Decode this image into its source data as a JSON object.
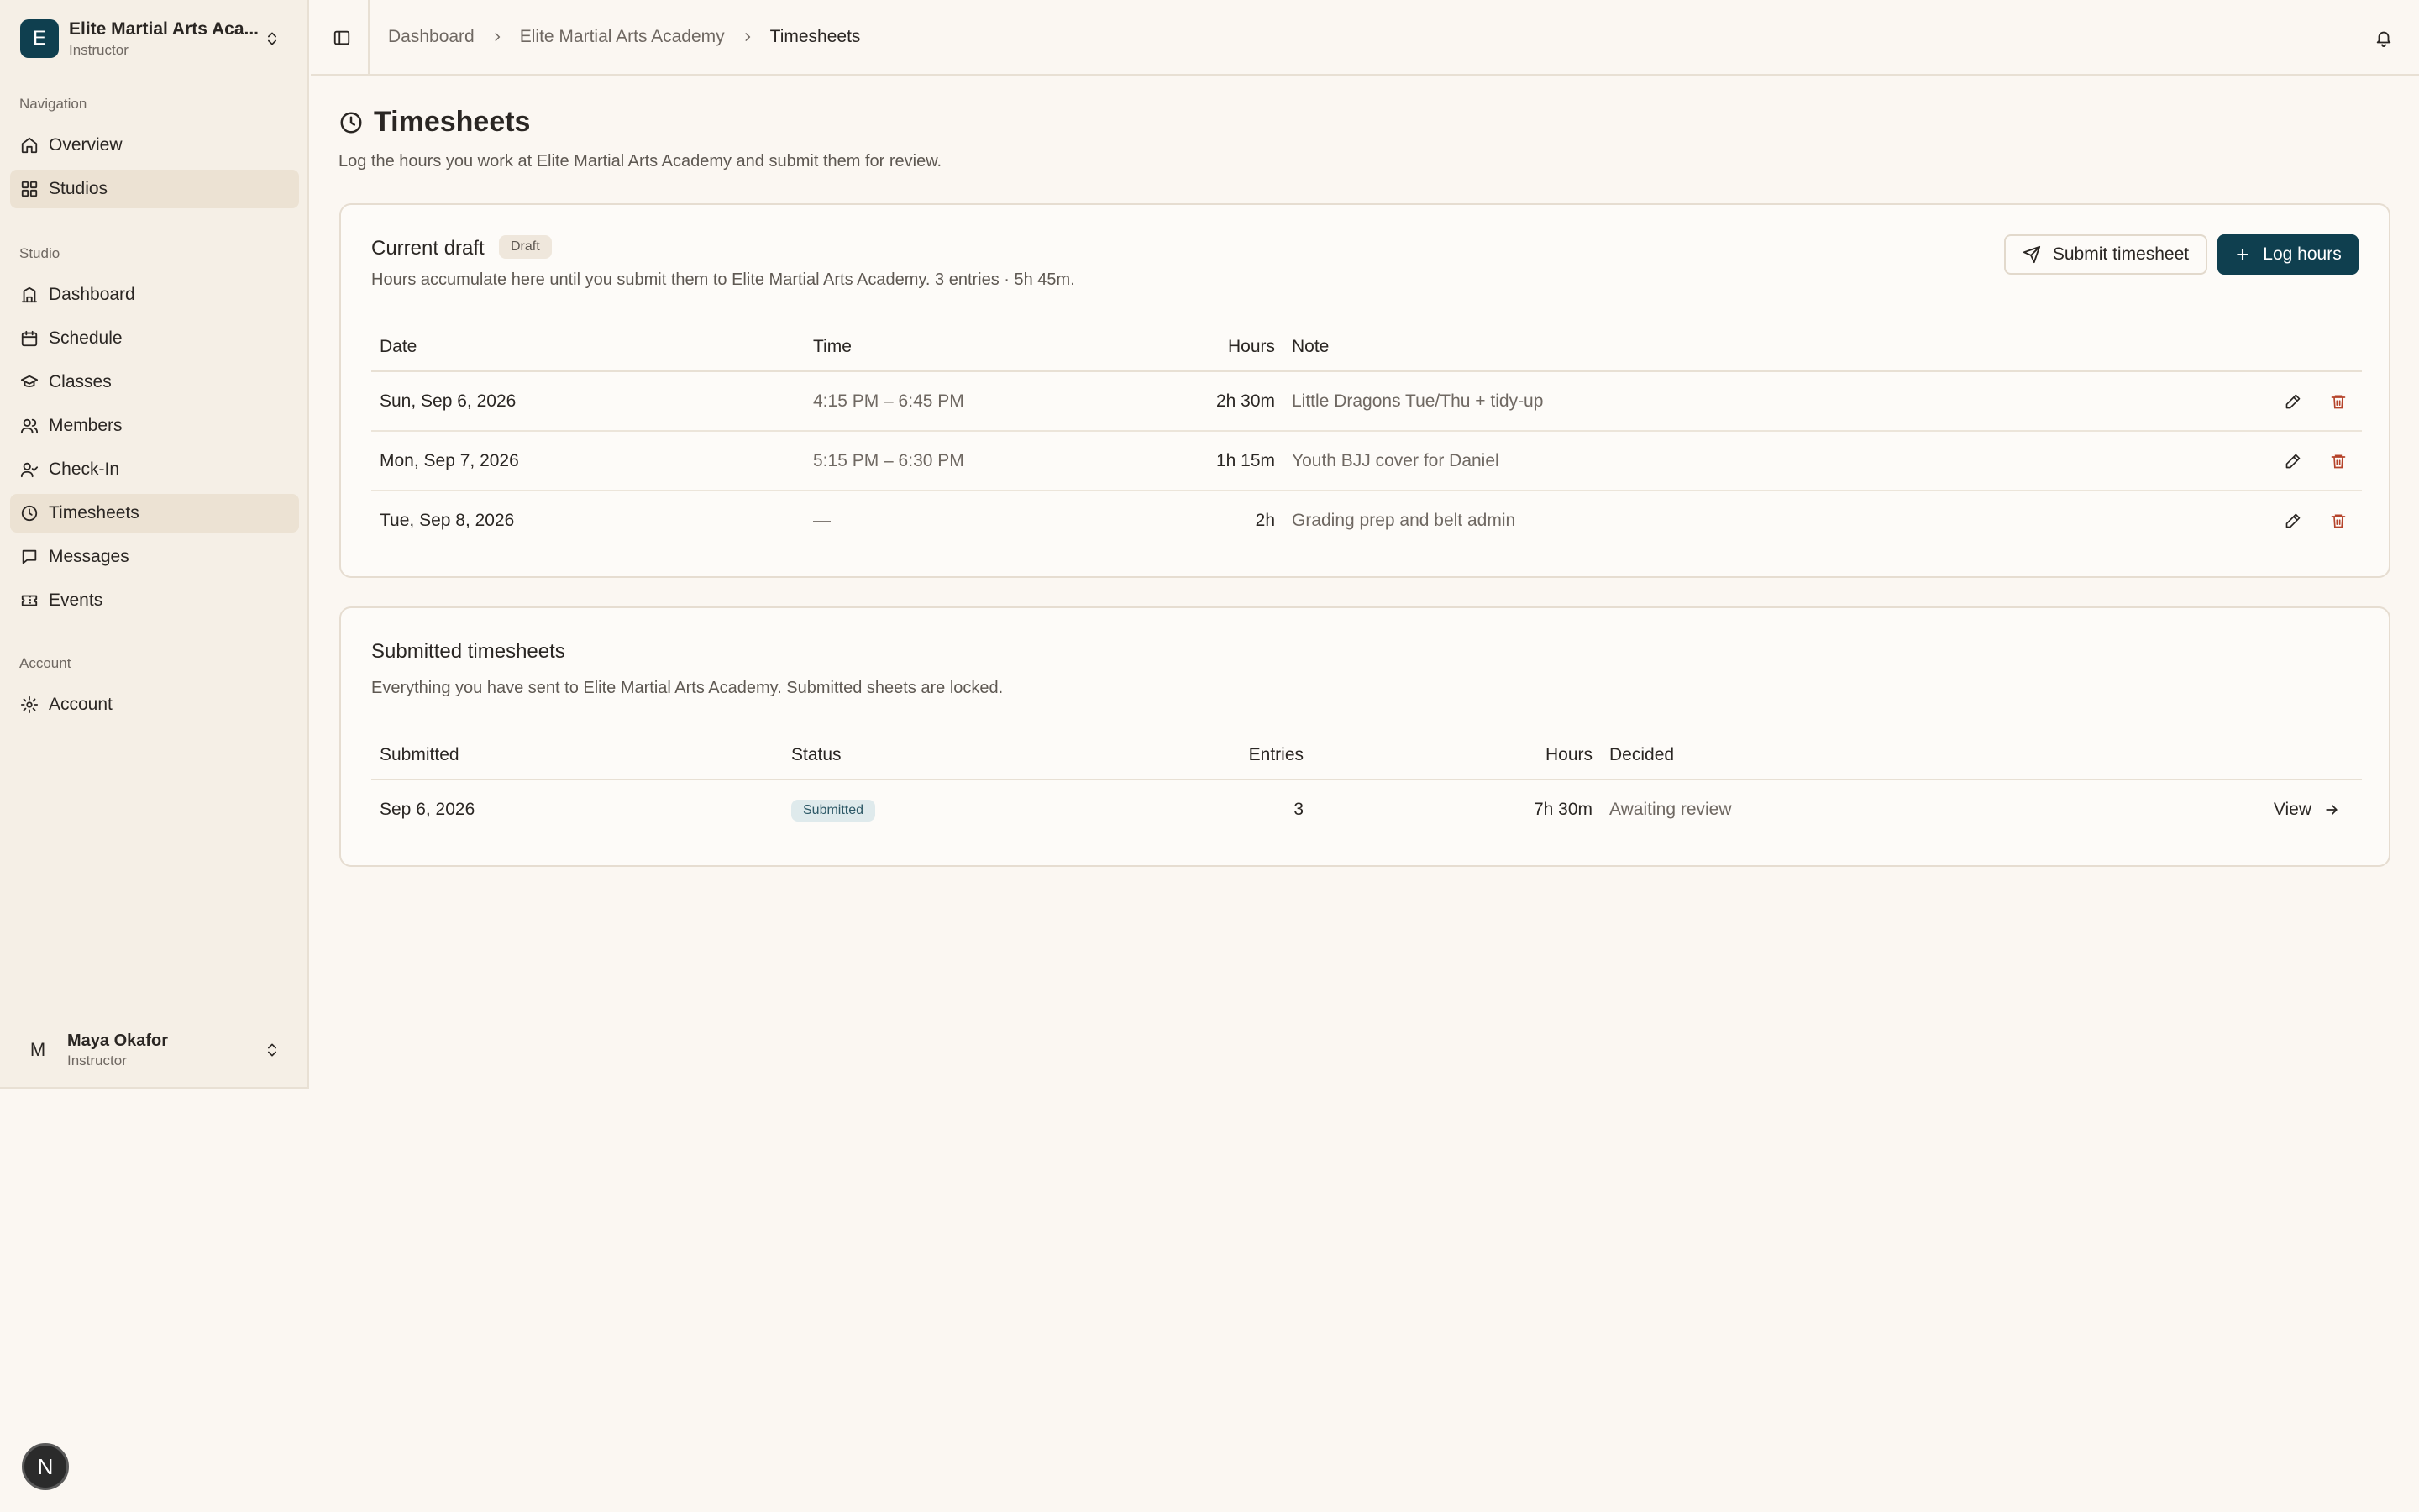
{
  "org": {
    "avatar_letter": "E",
    "name": "Elite Martial Arts Aca...",
    "role": "Instructor"
  },
  "nav": {
    "navigation_label": "Navigation",
    "navigation_items": [
      {
        "label": "Overview",
        "icon": "home-icon"
      },
      {
        "label": "Studios",
        "icon": "grid-icon",
        "active": true
      }
    ],
    "studio_label": "Studio",
    "studio_items": [
      {
        "label": "Dashboard",
        "icon": "dashboard-icon"
      },
      {
        "label": "Schedule",
        "icon": "calendar-icon"
      },
      {
        "label": "Classes",
        "icon": "graduation-cap-icon"
      },
      {
        "label": "Members",
        "icon": "users-icon"
      },
      {
        "label": "Check-In",
        "icon": "user-check-icon"
      },
      {
        "label": "Timesheets",
        "icon": "clock-icon",
        "active": true
      },
      {
        "label": "Messages",
        "icon": "message-icon"
      },
      {
        "label": "Events",
        "icon": "ticket-icon"
      }
    ],
    "account_label": "Account",
    "account_items": [
      {
        "label": "Account",
        "icon": "gear-icon"
      }
    ]
  },
  "user": {
    "avatar_letter": "M",
    "name": "Maya Okafor",
    "role": "Instructor"
  },
  "breadcrumb": [
    "Dashboard",
    "Elite Martial Arts Academy",
    "Timesheets"
  ],
  "page": {
    "title": "Timesheets",
    "subtitle": "Log the hours you work at Elite Martial Arts Academy and submit them for review."
  },
  "draft": {
    "title": "Current draft",
    "badge": "Draft",
    "description": "Hours accumulate here until you submit them to Elite Martial Arts Academy. 3 entries · 5h 45m.",
    "submit_label": "Submit timesheet",
    "log_label": "Log hours",
    "columns": [
      "Date",
      "Time",
      "Hours",
      "Note"
    ],
    "rows": [
      {
        "date": "Sun, Sep 6, 2026",
        "time": "4:15 PM – 6:45 PM",
        "hours": "2h 30m",
        "note": "Little Dragons Tue/Thu + tidy-up"
      },
      {
        "date": "Mon, Sep 7, 2026",
        "time": "5:15 PM – 6:30 PM",
        "hours": "1h 15m",
        "note": "Youth BJJ cover for Daniel"
      },
      {
        "date": "Tue, Sep 8, 2026",
        "time": "—",
        "hours": "2h",
        "note": "Grading prep and belt admin"
      }
    ]
  },
  "submitted": {
    "title": "Submitted timesheets",
    "description": "Everything you have sent to Elite Martial Arts Academy. Submitted sheets are locked.",
    "columns": [
      "Submitted",
      "Status",
      "Entries",
      "Hours",
      "Decided"
    ],
    "rows": [
      {
        "submitted": "Sep 6, 2026",
        "status": "Submitted",
        "entries": "3",
        "hours": "7h 30m",
        "decided": "Awaiting review",
        "action": "View"
      }
    ]
  },
  "next_badge": "N",
  "colors": {
    "accent": "#0f3f4f",
    "delete": "#b5432a",
    "background": "#fbf7f2",
    "sidebar": "#f5efe6"
  }
}
